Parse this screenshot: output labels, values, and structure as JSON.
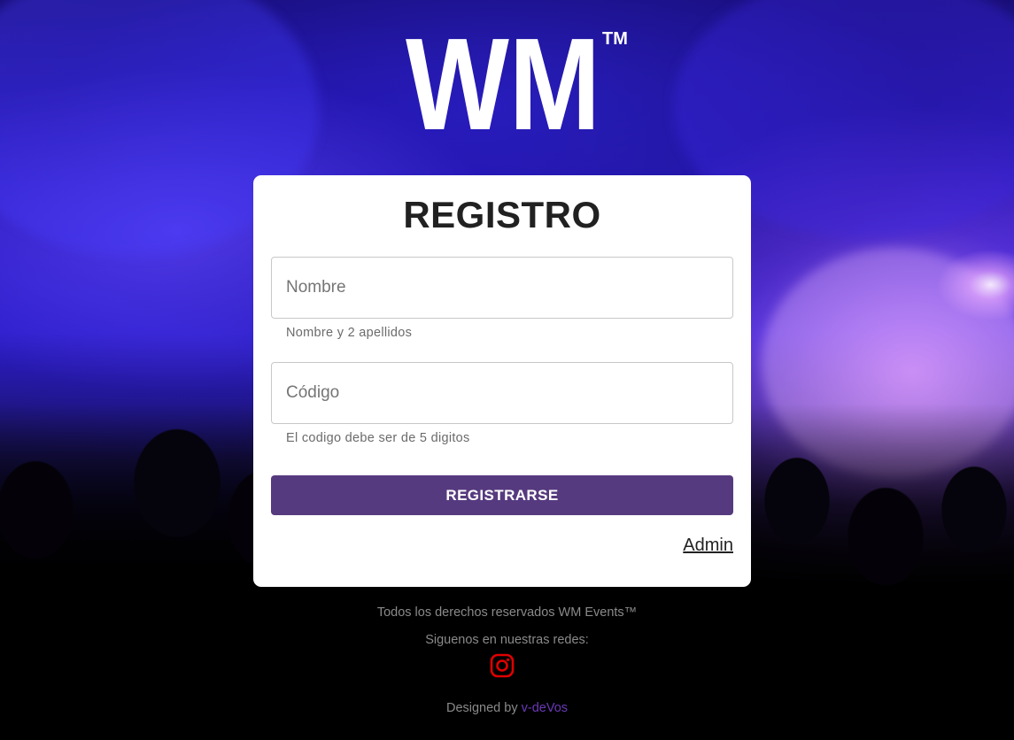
{
  "logo": {
    "text": "WM",
    "trademark": "TM"
  },
  "registro": {
    "title": "REGISTRO",
    "name_field": {
      "placeholder": "Nombre",
      "value": "",
      "helper": "Nombre y 2 apellidos"
    },
    "code_field": {
      "placeholder": "Código",
      "value": "",
      "helper": "El codigo debe ser de 5 digitos"
    },
    "submit_label": "REGISTRARSE",
    "admin_link": "Admin"
  },
  "footer": {
    "copyright": "Todos los derechos reservados WM Events™",
    "social_text": "Siguenos en nuestras redes:",
    "social_icon": "instagram-icon",
    "designed_by_prefix": "Designed by",
    "designer_name": "v-deVos"
  },
  "colors": {
    "button": "#563a7f",
    "instagram": "#e00000",
    "designer_link": "#6b39b8",
    "card_background": "#ffffff"
  }
}
